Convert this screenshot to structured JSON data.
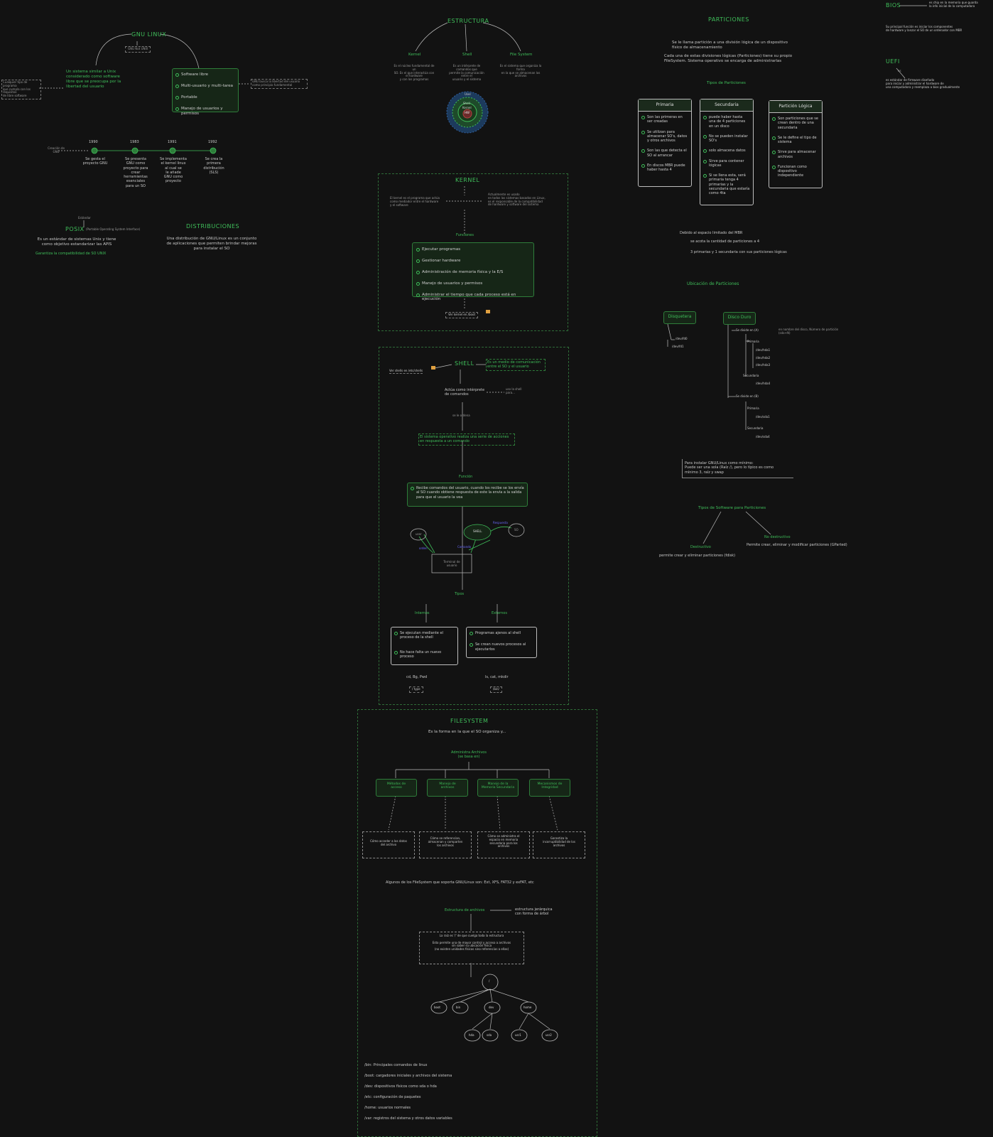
{
  "gnu": {
    "title": "GNU LINUX",
    "tag": "GNU Not UNIX",
    "desc": "Un sistema similar a Unix\nconsiderado como software\nlibre que se preocupa por la\nlibertad del usuario",
    "features": [
      "Software libre",
      "Multi-usuario y multi-tarea",
      "Portable",
      "Manejo de usuarios y permisos"
    ],
    "side_note_left": "Cualquier tipo de programa\nque cumpla con los requisitos\nde libre software",
    "side_note_right": "GNU busca la libertad del usuario\ncomo principio fundamental"
  },
  "timeline": {
    "label": "Creación de GNU",
    "items": [
      {
        "year": "1990",
        "text": "Se gesta el\nproyecto GNU"
      },
      {
        "year": "1983",
        "text": "Se presenta\nGNU como\nproyecto para\ncrear\nherramientas\nesenciales\npara un SO"
      },
      {
        "year": "1991",
        "text": "Se implementa\nel kernel linux\nal cual se\nle añade\nGNU como\nproyecto"
      },
      {
        "year": "1992",
        "text": "Se crea la\nprimera\ndistribución\n(SLS)"
      }
    ]
  },
  "posix": {
    "title": "POSIX",
    "subtitle": "(Portable Operating System Interface)",
    "desc": "Es un estándar de sistemas Unix y tiene\ncomo objetivo estandarizar las APIS",
    "note": "Garantiza la compatibilidad de SO UNIX",
    "top_note": "Estándar"
  },
  "distros": {
    "title": "DISTRIBUCIONES",
    "desc": "Una distribución de GNU/Linux es un conjunto\nde aplicaciones que permiten brindar mejoras\npara instalar el SO"
  },
  "estructura": {
    "title": "ESTRUCTURA",
    "branches": [
      {
        "name": "Kernel",
        "desc": "Es el núcleo fundamental de un\nSO. Es el que interactúa con el hardware\ny con los programas"
      },
      {
        "name": "Shell",
        "desc": "Es un intérprete de comandos que\npermite la comunicación entre el\nusuario y el sistema"
      },
      {
        "name": "File System",
        "desc": "Es el sistema que organiza la forma\nen la que se almacenan los\narchivos"
      }
    ],
    "rings": [
      "User",
      "Shell",
      "Kernel",
      "HW"
    ]
  },
  "kernel": {
    "title": "KERNEL",
    "left_note": "El kernel es el programa que actúa\ncomo mediador entre el hardware\ny el software",
    "right_note": "Actualmente es usado\nen todos los sistemas basados en Linux,\nes el responsable de la compatibilidad\nde hardware y software del sistema",
    "func_title": "Funciones",
    "functions": [
      "Ejecutar programas",
      "Gestionar hardware",
      "Administración de memoria física y la E/S",
      "Manejo de usuarios y permisos",
      "Administrar el tiempo que cada proceso está en ejecución"
    ],
    "footer": "Ver kernel en /boot"
  },
  "shell": {
    "title": "SHELL",
    "path_note": "Ver shells en /etc/shells",
    "def_note": "Es un medio de comunicación\nentre el SO y el usuario",
    "step1": "Actúa como intérprete\nde comandos",
    "step1_side": "uso la shell\npara...",
    "step_arrow": "se le ordena",
    "step2": "El sistema operativo realiza una serie de acciones\nen respuesta a un comando",
    "func_title": "Función",
    "func_text": "Recibe comandos del usuario, cuando los recibe\nse los envía al SO cuando obtiene respuesta de este\nla envía a la salida para que el usuario la vea",
    "cycle": {
      "user": "user",
      "shell": "SHELL",
      "so": "SO",
      "term": "Terminal de\nusuario",
      "a1": "Respuesta",
      "a2": "orden",
      "a3": "Comando"
    },
    "types_title": "Tipos",
    "internal_title": "Internos",
    "internal_items": [
      "Se ejecutan mediante el proceso de la shell",
      "No hace falta un nuevo proceso"
    ],
    "external_title": "Externos",
    "external_items": [
      "Programas ajenos al shell",
      "Se crean nuevos procesos al ejecutarlos"
    ],
    "internal_ex": "cd, Bg, Pwd",
    "external_ex": "ls, cat, mkdir",
    "internal_path": "/ type",
    "external_path": "/bin/"
  },
  "filesystem": {
    "title": "FILESYSTEM",
    "subtitle": "Es la forma en la que el SO organiza y...",
    "admin": "Administra Archivos\n(se basa en)",
    "boxes": [
      "Métodos de\nacceso",
      "Manejo de\narchivos",
      "Manejo de la\nMemoria Secundaria",
      "Mecanismos de\nIntegridad"
    ],
    "descs": [
      "Cómo acceder a los datos\ndel archivo",
      "Cómo se referencian,\nalmacenan y comparten\nlos archivos",
      "Cómo se administra el\nespacio en memoria\nsecundaria para los\narchivos",
      "Garantiza la\nincorruptibilidad de los\narchivos"
    ],
    "supported": "Algunos de los FileSystem que soporta GNU/Linux son: Ext, XFS, FAT32 y exFAT, etc",
    "struct_left": "Estructura de archivos",
    "struct_right": "estructura jerárquica\ncon forma de árbol",
    "root_box": "La raíz es '/' de que cuelga toda la estructura\n\nEsto permite una de mayor control y acceso a archivos\nsin saber su ubicación física\n(no existen unidades físicas sino referencias a ellas)",
    "tree": [
      "/",
      "boot",
      "bin",
      "dev",
      "home",
      "hda",
      "sda",
      "usr1",
      "usr2"
    ],
    "dirs": [
      "/bin: Principales comandos de linux",
      "/boot: cargadores iniciales y archivos del sistema",
      "/dev: dispositivos físicos como sda o hda",
      "/etc: configuración de paquetes",
      "/home: usuarios normales",
      "/var: registros del sistema y otros datos variables"
    ]
  },
  "particiones": {
    "title": "PARTICIONES",
    "desc1": "Se le llama partición a una división lógica de un dispositivo\nfísico de almacenamiento",
    "desc2": "Cada una de estas divisiones lógicas (Particiones) tiene su propio\nFileSystem. Sistema operativo se encarga de administrarlas",
    "types_title": "Tipos de Particiones",
    "primaria_title": "Primaria",
    "primaria": [
      "Son las primeras en ser creadas",
      "Se utilizan para almacenar SO's, datos y otros archivos",
      "Son las que detecta el SO al arrancar",
      "En discos MBR puede haber hasta 4"
    ],
    "secundaria_title": "Secundaria",
    "secundaria": [
      "puede haber hasta una de 4 particiones en un disco",
      "No se pueden instalar SO's",
      "solo almacena datos",
      "Sirve para contener lógicas",
      "Si se llena esta, será primaria tenga 4 primarias y la secundaria que estaría como 4ta"
    ],
    "logica_title": "Partición Lógica",
    "logica": [
      "Son particiones que se crean dentro de una secundaria",
      "Se le define el tipo de sistema",
      "Sirve para almacenar archivos",
      "Funcionan como dispositivo independiente"
    ],
    "note1": "Debido al espacio limitado del MBR",
    "note2": "se acota la cantidad de particiones a 4",
    "note3": "3 primarias y 1 secundaria con sus particiones lógicas",
    "ubic_title": "Ubicación de Particiones",
    "disquetera": "Disquetera",
    "disco": "Disco Duro",
    "disq_items": [
      "/dev/fd0",
      "/dev/fd1"
    ],
    "hd_items": [
      "Se divide en (A)",
      "Primaria",
      "/dev/hda1",
      "/dev/hda2",
      "/dev/hda3",
      "Secundaria",
      "/dev/hda4",
      "Se divide en (B)",
      "Primaria",
      "/dev/sda1",
      "Secundaria",
      "/dev/sda4"
    ],
    "hd_note": "en nombre del disco, Número de partición\n(sda+N)",
    "install_note": "Para instalar GNU/Linux como mínimo:\n  Puede ser una sola (Raíz /), pero lo típico es como\n  mínimo 3, raíz y swap",
    "sw_title": "Tipos de Software para Particiones",
    "destructivo": "Destructivo",
    "destructivo_desc": "permite crear y eliminar particiones (fdisk)",
    "no_destructivo": "No destructivo",
    "no_destructivo_desc": "Permite crear, eliminar y modificar particiones (GParted)"
  },
  "bios": {
    "title": "BIOS",
    "arrow_note": "es chip en la memoria que guarda\nla info inicial de la computadora",
    "desc": "Su principal función es iniciar los componentes\nde hardware y lanzar el SO de un ordenador con MBR"
  },
  "uefi": {
    "title": "UEFI",
    "arrow_label": "es",
    "desc": "es estándar de firmware diseñado\npara iniciar y administrar el hardware de\nuna computadora y reemplaza a bios gradualmente"
  }
}
